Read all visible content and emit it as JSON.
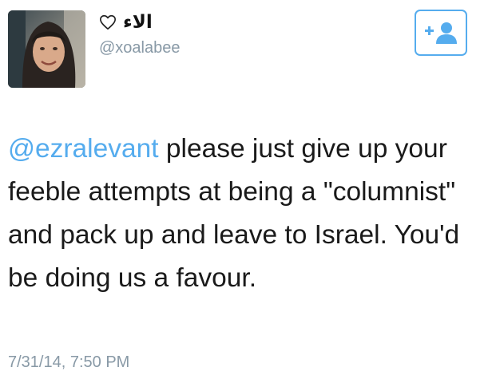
{
  "user": {
    "display_name": "الاء",
    "handle": "@xoalabee",
    "heart_icon": "heart-outline-icon"
  },
  "follow_button": {
    "icon": "add-user-icon",
    "color": "#55acee"
  },
  "tweet": {
    "mention": "@ezralevant",
    "body": " please just give up your feeble attempts at being a \"columnist\" and pack up and leave to Israel. You'd be doing us a favour.",
    "timestamp": "7/31/14, 7:50 PM"
  },
  "colors": {
    "accent": "#55acee",
    "secondary_text": "#8899a6",
    "text": "#1a1a1a"
  }
}
